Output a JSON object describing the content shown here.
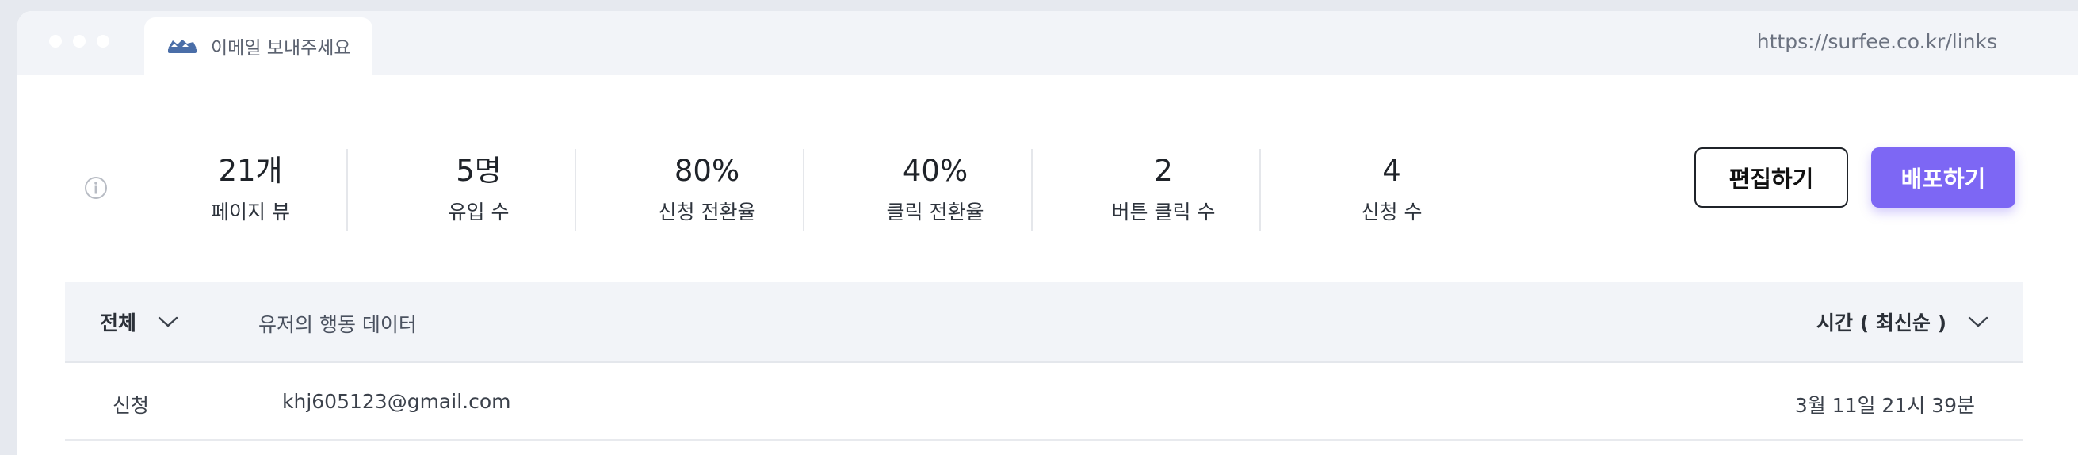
{
  "browser": {
    "tab_title": "이메일 보내주세요",
    "url": "https://surfee.co.kr/links"
  },
  "stats": [
    {
      "value": "21개",
      "label": "페이지 뷰"
    },
    {
      "value": "5명",
      "label": "유입 수"
    },
    {
      "value": "80%",
      "label": "신청 전환율"
    },
    {
      "value": "40%",
      "label": "클릭 전환율"
    },
    {
      "value": "2",
      "label": "버튼 클릭 수"
    },
    {
      "value": "4",
      "label": "신청 수"
    }
  ],
  "actions": {
    "edit_label": "편집하기",
    "deploy_label": "배포하기"
  },
  "table": {
    "filter_label": "전체",
    "data_header": "유저의 행동 데이터",
    "sort_label": "시간 ( 최신순 )",
    "rows": [
      {
        "type": "신청",
        "email": "khj605123@gmail.com",
        "time": "3월 11일 21시 39분"
      }
    ]
  },
  "colors": {
    "accent": "#7d67f4",
    "tab_icon": "#4a6ea8"
  }
}
